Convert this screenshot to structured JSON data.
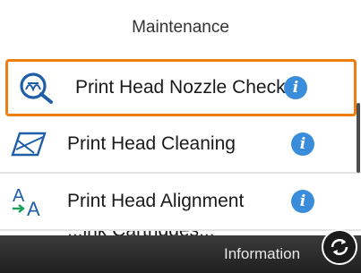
{
  "header": {
    "title": "Maintenance"
  },
  "menu": {
    "items": [
      {
        "label": "Print Head Nozzle Check",
        "icon": "nozzle-check-icon",
        "info_icon": "info-icon",
        "selected": true
      },
      {
        "label": "Print Head Cleaning",
        "icon": "head-cleaning-icon",
        "info_icon": "info-icon",
        "selected": false
      },
      {
        "label": "Print Head Alignment",
        "icon": "head-alignment-icon",
        "info_icon": "info-icon",
        "selected": false
      }
    ],
    "partial_item_label": "...ink Cartridges..."
  },
  "bottom_bar": {
    "label": "Information",
    "refresh_icon": "refresh-icon"
  },
  "colors": {
    "selection_border": "#f07d0f",
    "info_blue": "#3a8ddb",
    "bottom_bar": "#2a2a2a",
    "icon_blue": "#1f5fa8"
  }
}
